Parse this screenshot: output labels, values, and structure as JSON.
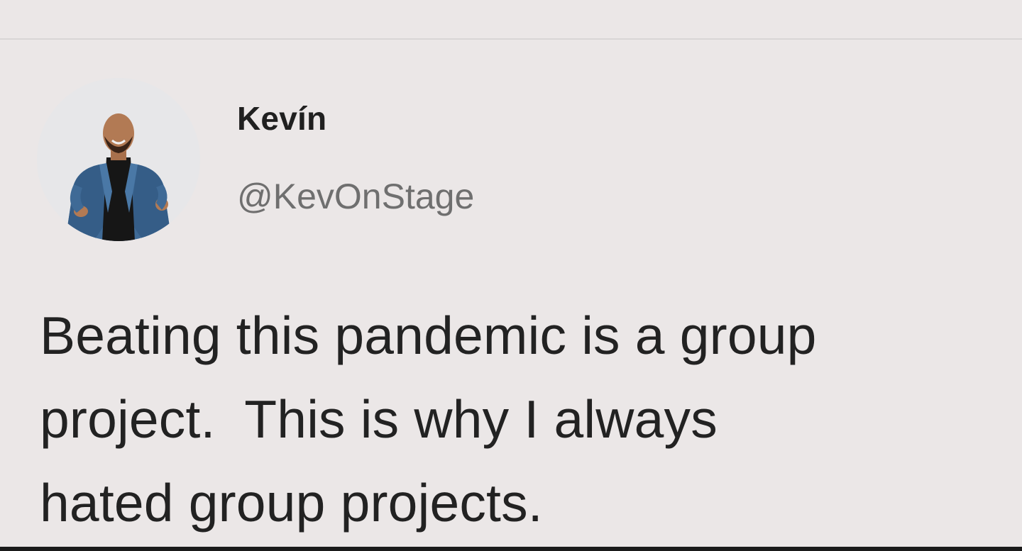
{
  "tweet": {
    "display_name": "Kevín",
    "handle": "@KevOnStage",
    "text_lines": [
      "Beating this pandemic is a group",
      "project.  This is why I always",
      "hated group projects."
    ]
  },
  "colors": {
    "background": "#ebe7e7",
    "text": "#222222",
    "handle": "#6f6f6f"
  },
  "icons": [
    "avatar-photo"
  ]
}
